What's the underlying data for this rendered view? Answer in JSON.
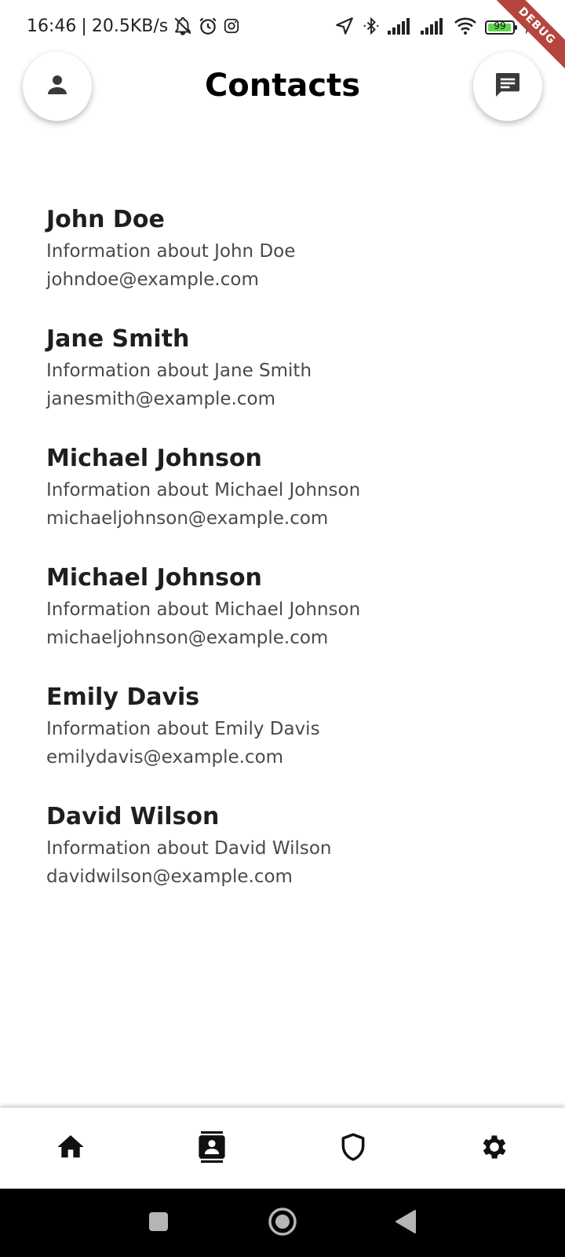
{
  "status_bar": {
    "time": "16:46",
    "speed": "20.5KB/s",
    "battery_level": "99",
    "icons": [
      "notifications-off-icon",
      "alarm-icon",
      "instagram-icon",
      "location-arrow-icon",
      "bluetooth-icon",
      "signal-icon",
      "signal-icon",
      "wifi-icon",
      "battery-icon",
      "charging-icon"
    ]
  },
  "debug_banner": "DEBUG",
  "header": {
    "title": "Contacts",
    "left_button_icon": "person-icon",
    "right_button_icon": "message-icon"
  },
  "contacts": [
    {
      "name": "John Doe",
      "info": "Information about John Doe",
      "email": "johndoe@example.com"
    },
    {
      "name": "Jane Smith",
      "info": "Information about Jane Smith",
      "email": "janesmith@example.com"
    },
    {
      "name": "Michael Johnson",
      "info": "Information about Michael Johnson",
      "email": "michaeljohnson@example.com"
    },
    {
      "name": "Michael Johnson",
      "info": "Information about Michael Johnson",
      "email": "michaeljohnson@example.com"
    },
    {
      "name": "Emily Davis",
      "info": "Information about Emily Davis",
      "email": "emilydavis@example.com"
    },
    {
      "name": "David Wilson",
      "info": "Information about David Wilson",
      "email": "davidwilson@example.com"
    }
  ],
  "bottom_nav": {
    "items": [
      {
        "icon": "home-icon"
      },
      {
        "icon": "contacts-icon",
        "selected": true
      },
      {
        "icon": "shield-icon"
      },
      {
        "icon": "settings-icon"
      }
    ]
  },
  "system_nav": {
    "items": [
      "recents-icon",
      "home-circle-icon",
      "back-icon"
    ]
  }
}
